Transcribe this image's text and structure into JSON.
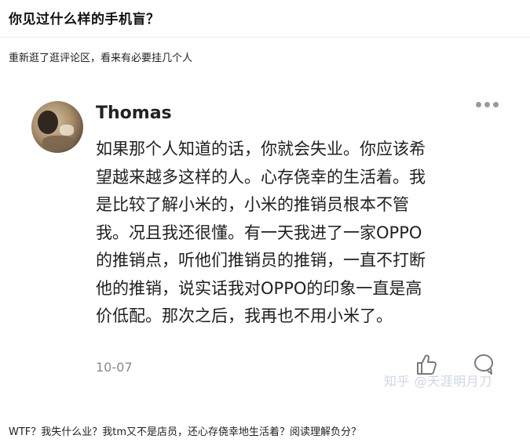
{
  "question": {
    "title": "你见过什么样的手机盲？"
  },
  "post": {
    "intro": "重新逛了逛评论区，看来有必要挂几个人"
  },
  "comment": {
    "author": "Thomas",
    "text": "如果那个人知道的话，你就会失业。你应该希\n望越来越多这样的人。心存侥幸的生活着。我\n是比较了解小米的，小米的推销员根本不管\n我。况且我还很懂。有一天我进了一家OPPO\n的推销点，听他们推销员的推销，一直不打断\n他的推销，说实话我对OPPO的印象一直是高\n价低配。那次之后，我再也不用小米了。",
    "date": "10-07",
    "icons": {
      "more": "more-dots-icon",
      "like": "thumbs-up-icon",
      "reply": "comment-bubble-icon"
    }
  },
  "watermark": "知乎 @天涯明月刀",
  "footer": {
    "text": "WTF？我失什么业？我tm又不是店员，还心存侥幸地生活着？阅读理解负分？"
  }
}
